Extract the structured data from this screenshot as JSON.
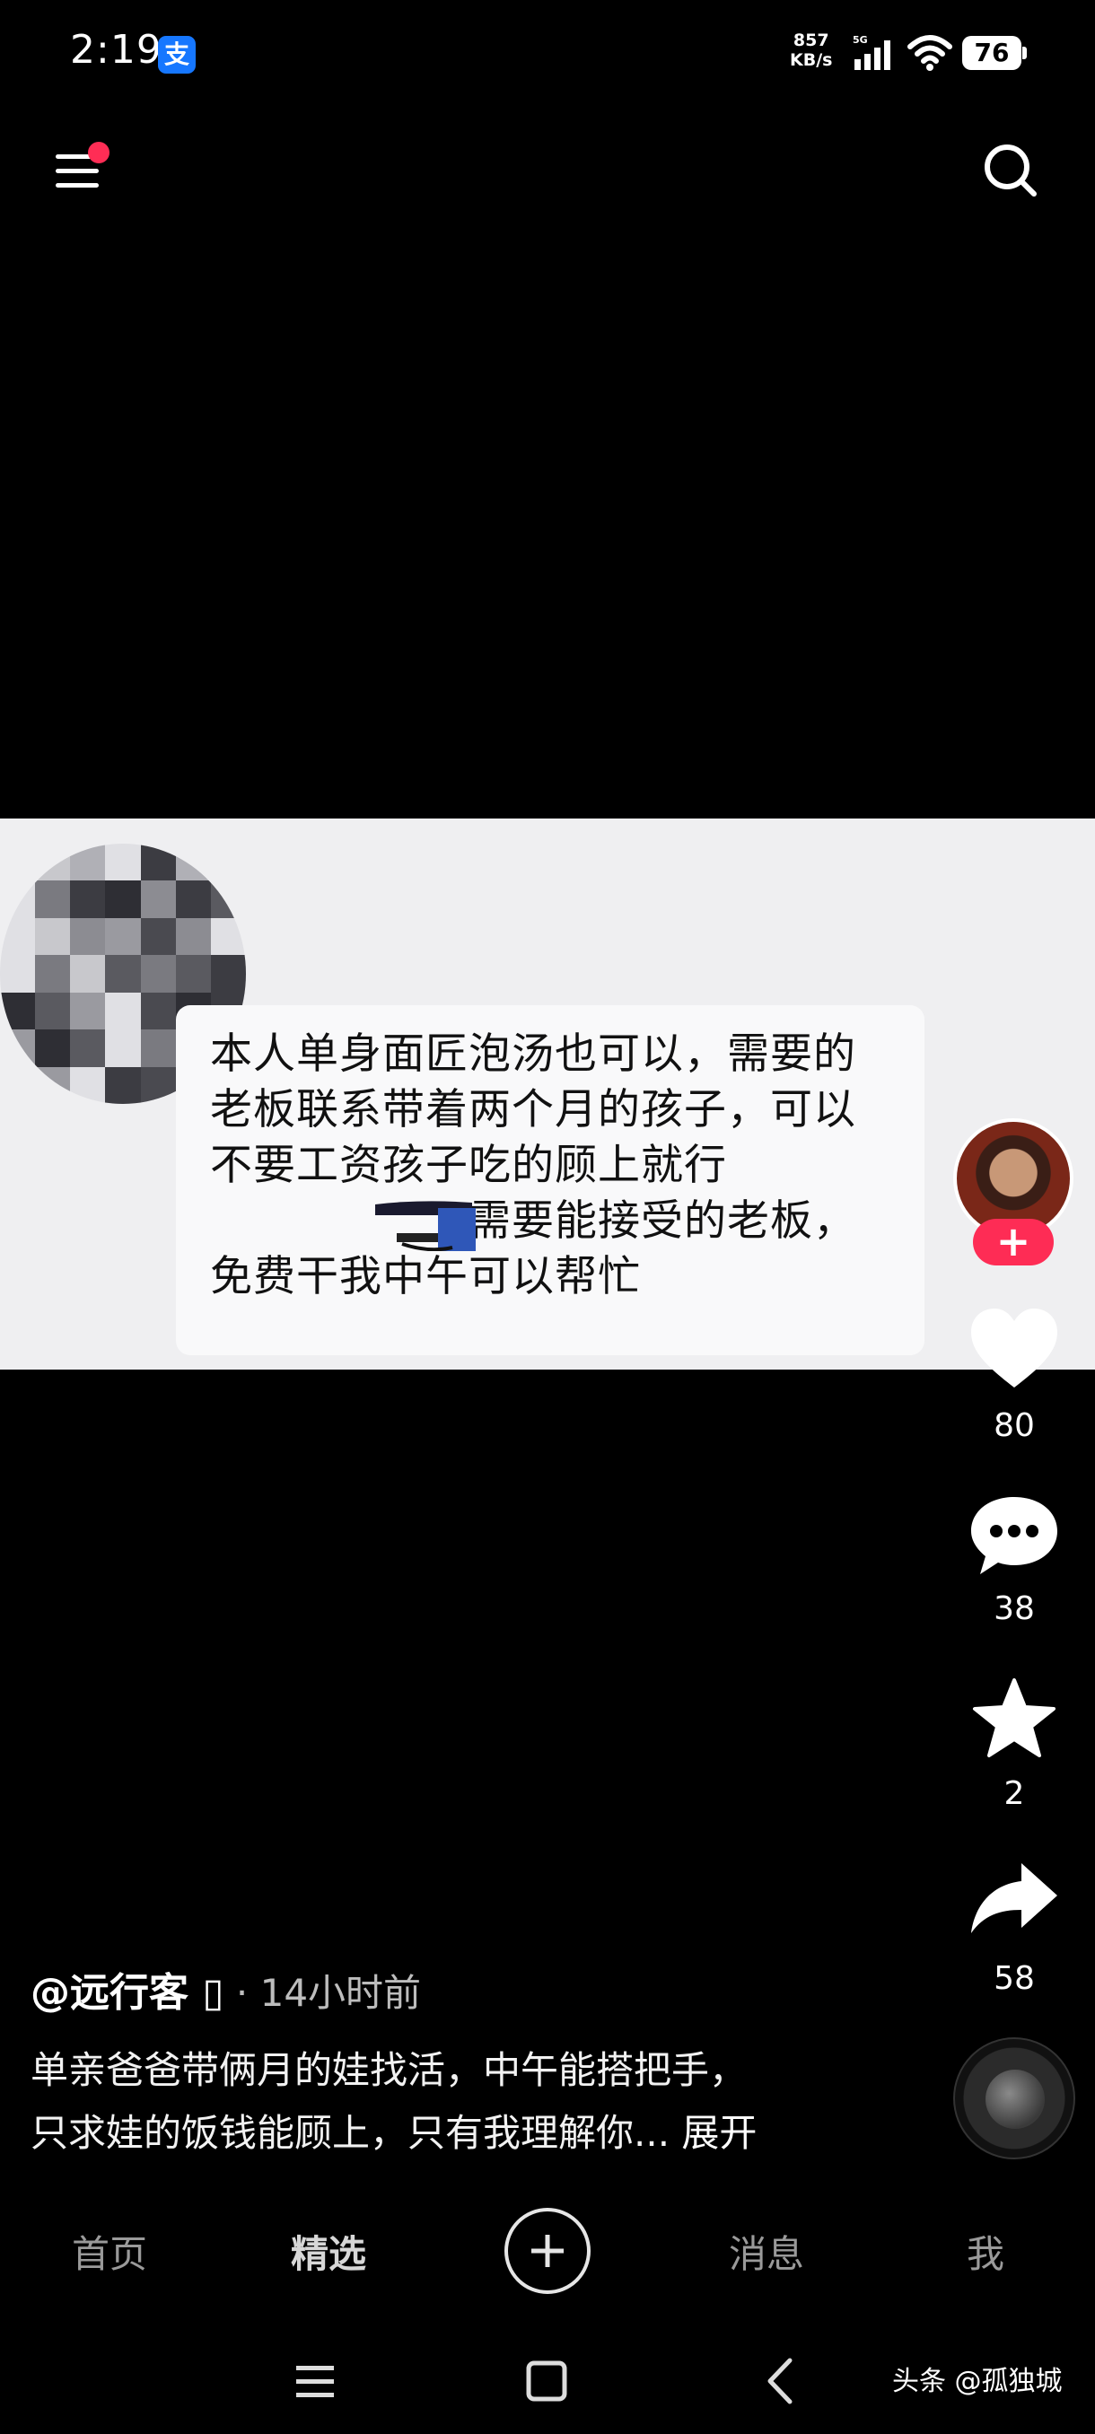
{
  "status_bar": {
    "time": "2:19",
    "app_icon_text": "支",
    "speed_value": "857",
    "speed_unit": "KB/s",
    "network": "5G",
    "battery": "76"
  },
  "post": {
    "text": "本人单身面匠泡汤也可以，需要的\n老板联系带着两个月的孩子，可以\n不要工资孩子吃的顾上就行\n　　　　　　需要能接受的老板，\n免费干我中午可以帮忙"
  },
  "actions": {
    "follow_label": "+",
    "likes": "80",
    "comments": "38",
    "favorites": "2",
    "shares": "58"
  },
  "author": {
    "name": "@远行客 ",
    "badge_glyph": "▯",
    "separator": " · ",
    "time": "14小时前"
  },
  "caption": {
    "line1": "单亲爸爸带俩月的娃找活，中午能搭把手，",
    "line2": "只求娃的饭钱能顾上，只有我理解你...",
    "expand": " 展开"
  },
  "nav": {
    "home": "首页",
    "featured": "精选",
    "messages": "消息",
    "me": "我"
  },
  "watermark": "头条 @孤独城",
  "colors": {
    "accent": "#fe2c55",
    "notification_dot": "#ff2d55",
    "app_icon_bg": "#1677ff",
    "post_bg": "#efeff1"
  }
}
